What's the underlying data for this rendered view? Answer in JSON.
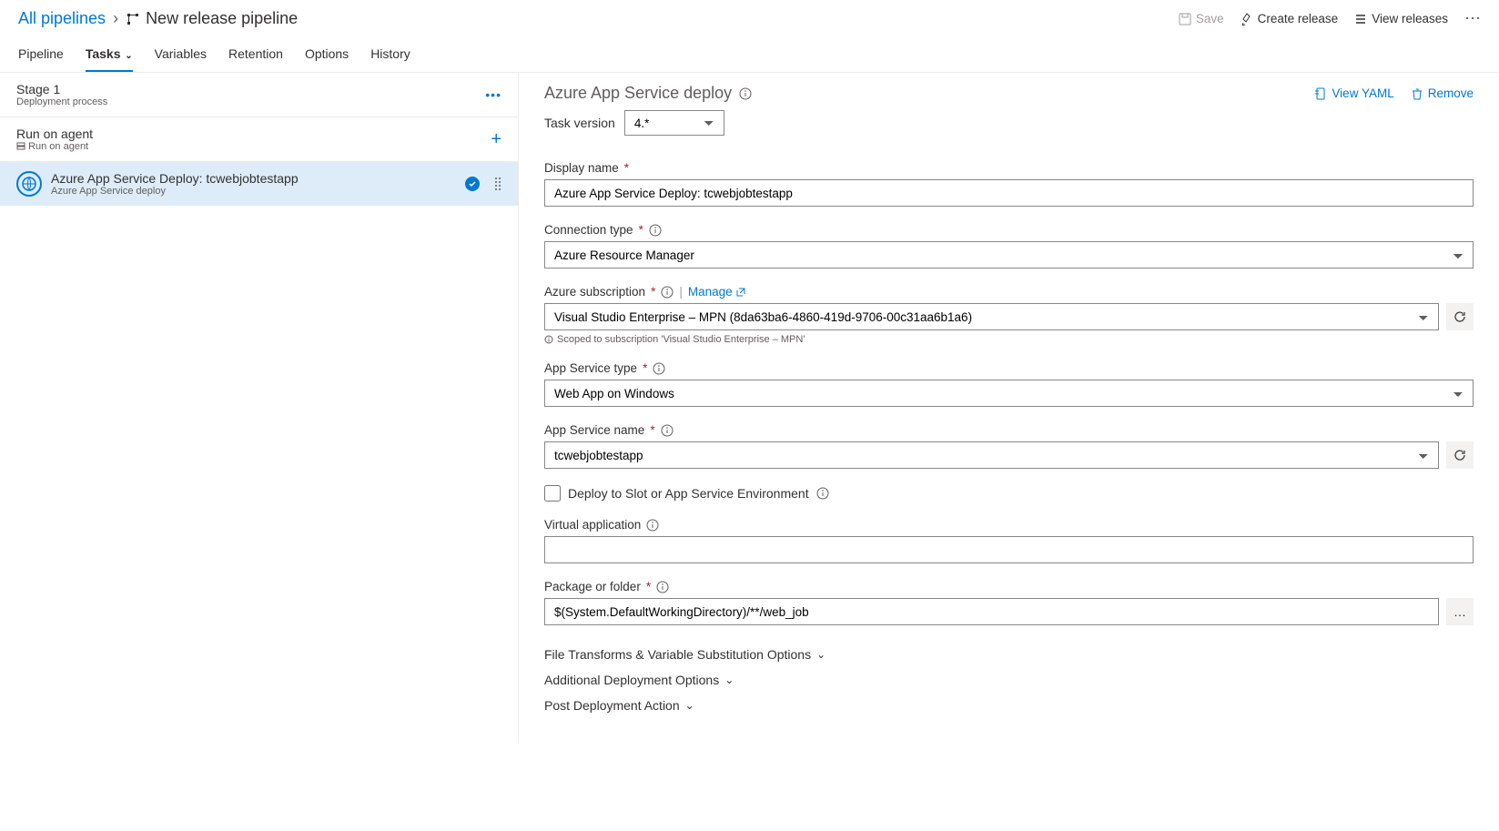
{
  "breadcrumb": {
    "root": "All pipelines",
    "title": "New release pipeline"
  },
  "topActions": {
    "save": "Save",
    "createRelease": "Create release",
    "viewReleases": "View releases"
  },
  "tabs": {
    "pipeline": "Pipeline",
    "tasks": "Tasks",
    "variables": "Variables",
    "retention": "Retention",
    "options": "Options",
    "history": "History"
  },
  "leftPanel": {
    "stage": {
      "title": "Stage 1",
      "subtitle": "Deployment process"
    },
    "agent": {
      "title": "Run on agent",
      "subtitle": "Run on agent"
    },
    "task": {
      "title": "Azure App Service Deploy: tcwebjobtestapp",
      "subtitle": "Azure App Service deploy"
    }
  },
  "detail": {
    "heading": "Azure App Service deploy",
    "actions": {
      "viewYaml": "View YAML",
      "remove": "Remove"
    },
    "taskVersionLabel": "Task version",
    "taskVersionValue": "4.*",
    "displayName": {
      "label": "Display name",
      "value": "Azure App Service Deploy: tcwebjobtestapp"
    },
    "connectionType": {
      "label": "Connection type",
      "value": "Azure Resource Manager"
    },
    "azureSubscription": {
      "label": "Azure subscription",
      "manage": "Manage",
      "value": "Visual Studio Enterprise – MPN (8da63ba6-4860-419d-9706-00c31aa6b1a6)",
      "scopeNote": "Scoped to subscription 'Visual Studio Enterprise – MPN'"
    },
    "appServiceType": {
      "label": "App Service type",
      "value": "Web App on Windows"
    },
    "appServiceName": {
      "label": "App Service name",
      "value": "tcwebjobtestapp"
    },
    "deployToSlot": {
      "label": "Deploy to Slot or App Service Environment"
    },
    "virtualApplication": {
      "label": "Virtual application",
      "value": ""
    },
    "packageOrFolder": {
      "label": "Package or folder",
      "value": "$(System.DefaultWorkingDirectory)/**/web_job"
    },
    "sections": {
      "fileTransforms": "File Transforms & Variable Substitution Options",
      "additionalDeployment": "Additional Deployment Options",
      "postDeployment": "Post Deployment Action"
    }
  }
}
